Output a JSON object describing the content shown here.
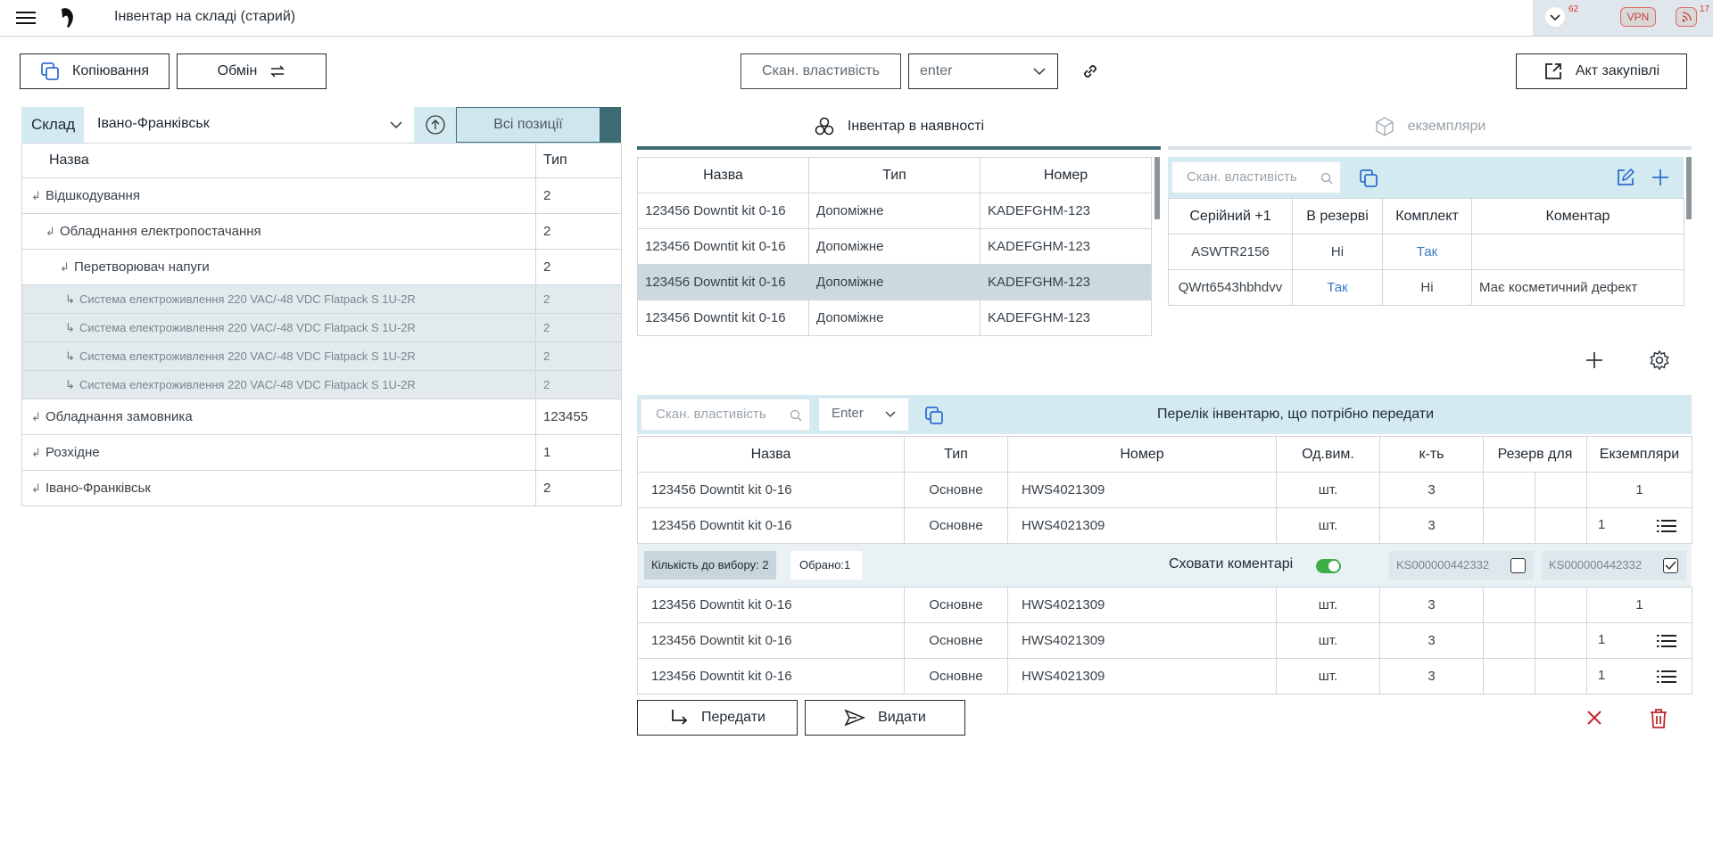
{
  "header": {
    "title": "Інвентар на складі (старий)",
    "notifications_count": "62",
    "vpn_label": "VPN",
    "feed_count": "17"
  },
  "toolbar": {
    "copy_label": "Копіювання",
    "exchange_label": "Обмін",
    "scan_label": "Скан. властивість",
    "enter_value": "enter",
    "purchase_act_label": "Акт закупівлі"
  },
  "warehouse": {
    "label": "Склад",
    "value": "Івано-Франківськ",
    "all_positions_label": "Всі позиції",
    "columns": [
      "Назва",
      "Тип"
    ],
    "rows": [
      {
        "name": "Відшкодування",
        "type": "2"
      },
      {
        "name": "Обладнання електропостачання",
        "type": "2"
      },
      {
        "name": "Перетворювач напуги",
        "type": "2"
      },
      {
        "name": "Система електроживлення 220 VAC/-48 VDC Flatpack S 1U-2R",
        "type": "2"
      },
      {
        "name": "Система електроживлення 220 VAC/-48 VDC Flatpack S 1U-2R",
        "type": "2"
      },
      {
        "name": "Система електроживлення 220 VAC/-48 VDC Flatpack S 1U-2R",
        "type": "2"
      },
      {
        "name": "Система електроживлення 220 VAC/-48 VDC Flatpack S 1U-2R",
        "type": "2"
      },
      {
        "name": "Обладнання замовника",
        "type": "123455"
      },
      {
        "name": "Розхідне",
        "type": "1"
      },
      {
        "name": "Івано-Франківськ",
        "type": "2"
      }
    ]
  },
  "tabs": {
    "available": "Інвентар в наявності",
    "instances": "екземпляри"
  },
  "inventory": {
    "columns": [
      "Назва",
      "Тип",
      "Номер"
    ],
    "rows": [
      {
        "name": "123456 Downtit kit 0-16",
        "type": "Допоміжне",
        "number": "KADEFGHM-123"
      },
      {
        "name": "123456 Downtit kit 0-16",
        "type": "Допоміжне",
        "number": "KADEFGHM-123"
      },
      {
        "name": "123456 Downtit kit 0-16",
        "type": "Допоміжне",
        "number": "KADEFGHM-123"
      },
      {
        "name": "123456 Downtit kit 0-16",
        "type": "Допоміжне",
        "number": "KADEFGHM-123"
      }
    ]
  },
  "instances": {
    "search_placeholder": "Скан. властивість",
    "columns": [
      "Серійний +1",
      "В резерві",
      "Комплект",
      "Коментар"
    ],
    "rows": [
      {
        "serial": "ASWTR2156",
        "reserved": "Ні",
        "kit": "Так",
        "comment": ""
      },
      {
        "serial": "QWrt6543hbhdvv",
        "reserved": "Так",
        "kit": "Ні",
        "comment": "Має косметичний дефект"
      }
    ]
  },
  "transfer": {
    "search_placeholder": "Скан. властивість",
    "enter_value": "Enter",
    "title": "Перелік інвентарю, що потрібно передати",
    "columns": [
      "Назва",
      "Тип",
      "Номер",
      "Од.вим.",
      "к-ть",
      "Резерв для",
      "Екземпляри"
    ],
    "rows_top": [
      {
        "name": "123456 Downtit kit 0-16",
        "type": "Основне",
        "number": "HWS4021309",
        "unit": "шт.",
        "qty": "3",
        "instances": "1"
      },
      {
        "name": "123456 Downtit kit 0-16",
        "type": "Основне",
        "number": "HWS4021309",
        "unit": "шт.",
        "qty": "3",
        "instances": "1"
      }
    ],
    "selection": {
      "to_select": "Кількість до вибору: 2",
      "selected": "Обрано:1",
      "hide_comments": "Сховати коментарі",
      "item1": "KS000000442332",
      "item2": "KS000000442332"
    },
    "rows_bottom": [
      {
        "name": "123456 Downtit kit 0-16",
        "type": "Основне",
        "number": "HWS4021309",
        "unit": "шт.",
        "qty": "3",
        "instances": "1"
      },
      {
        "name": "123456 Downtit kit 0-16",
        "type": "Основне",
        "number": "HWS4021309",
        "unit": "шт.",
        "qty": "3",
        "instances": "1"
      },
      {
        "name": "123456 Downtit kit 0-16",
        "type": "Основне",
        "number": "HWS4021309",
        "unit": "шт.",
        "qty": "3",
        "instances": "1"
      }
    ]
  },
  "actions": {
    "transfer_label": "Передати",
    "issue_label": "Видати"
  },
  "colors": {
    "accent_light": "#d3eaf0",
    "accent_dark": "#3d6b73",
    "link": "#3a78c6",
    "danger": "#c0272d",
    "toggle": "#3fae49"
  }
}
